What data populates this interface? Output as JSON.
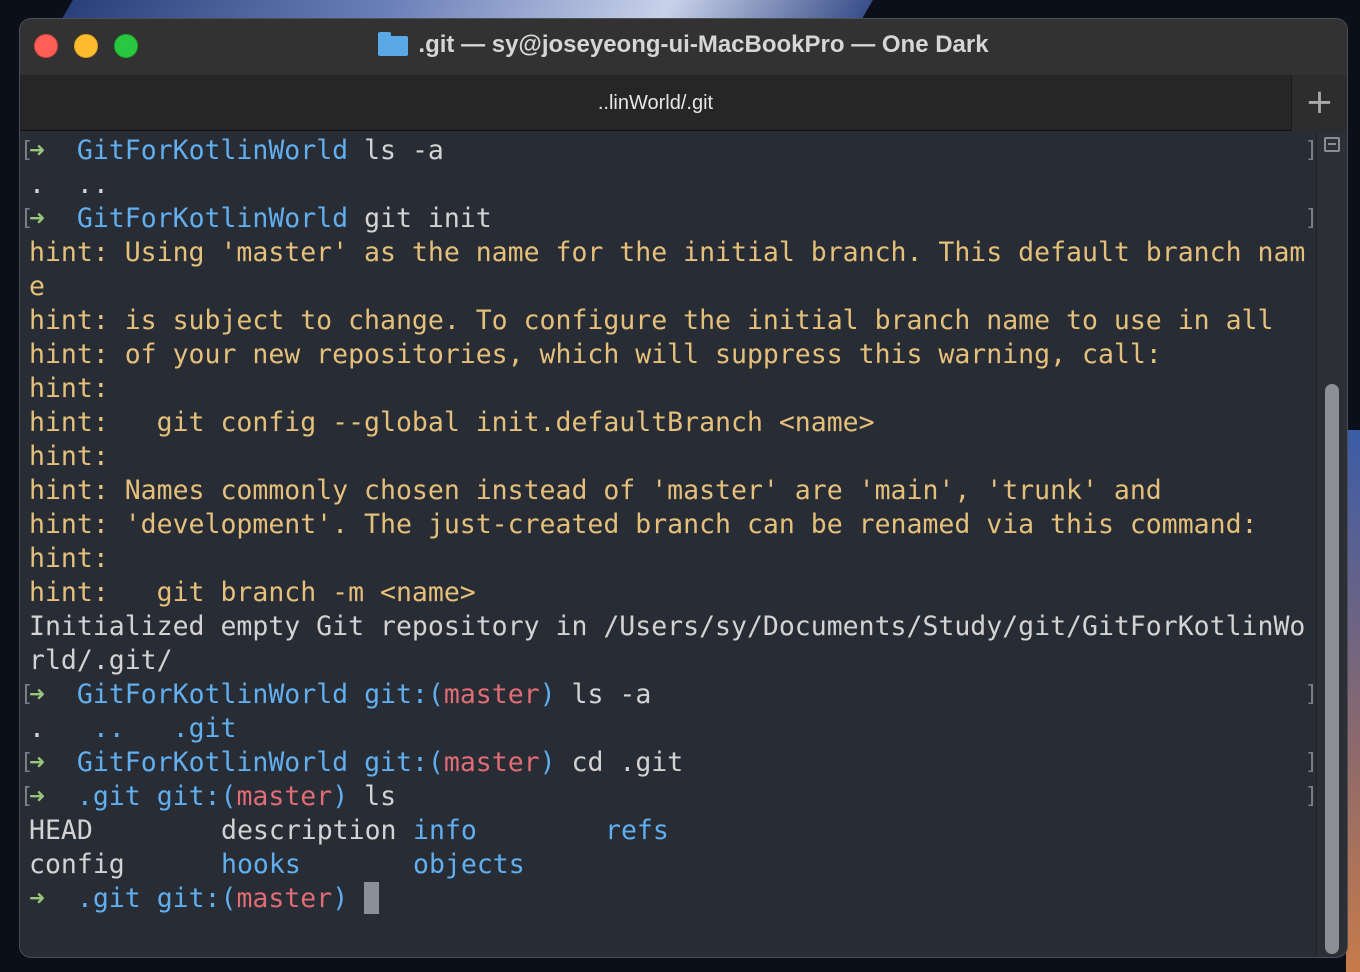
{
  "window": {
    "title": ".git — sy@joseyeong-ui-MacBookPro — One Dark",
    "folder_icon": "folder-icon",
    "traffic_lights": [
      "close",
      "minimize",
      "zoom"
    ]
  },
  "tabbar": {
    "tab_label": "..linWorld/.git",
    "new_tab_label": "+"
  },
  "colors": {
    "background": "#282c34",
    "prompt_arrow": "#98c379",
    "directory": "#61afef",
    "git_branch": "#e06c75",
    "hint_text": "#e5c07b",
    "plain_text": "#d3d3d3"
  },
  "terminal": {
    "prompt_arrow": "➜",
    "bracket_left": "[",
    "bracket_right": "]",
    "p1": {
      "dir": "GitForKotlinWorld",
      "cmd": " ls -a"
    },
    "out1": ".  ..",
    "p2": {
      "dir": "GitForKotlinWorld",
      "cmd": " git init"
    },
    "hints": [
      "hint: Using 'master' as the name for the initial branch. This default branch nam",
      "e",
      "hint: is subject to change. To configure the initial branch name to use in all",
      "hint: of your new repositories, which will suppress this warning, call:",
      "hint:",
      "hint:   git config --global init.defaultBranch <name>",
      "hint:",
      "hint: Names commonly chosen instead of 'master' are 'main', 'trunk' and",
      "hint: 'development'. The just-created branch can be renamed via this command:",
      "hint:",
      "hint:   git branch -m <name>"
    ],
    "init_msg": [
      "Initialized empty Git repository in /Users/sy/Documents/Study/git/GitForKotlinWo",
      "rld/.git/"
    ],
    "p3": {
      "dir": "GitForKotlinWorld",
      "git_open": "git:(",
      "branch": "master",
      "git_close": ")",
      "cmd": " ls -a"
    },
    "out3": {
      "a": ".",
      "b": "..",
      "c": ".git"
    },
    "p4": {
      "dir": "GitForKotlinWorld",
      "git_open": "git:(",
      "branch": "master",
      "git_close": ")",
      "cmd": " cd .git"
    },
    "p5": {
      "dir": ".git",
      "git_open": "git:(",
      "branch": "master",
      "git_close": ")",
      "cmd": " ls"
    },
    "ls_rows": [
      [
        "HEAD",
        "description",
        "info",
        "refs"
      ],
      [
        "config",
        "hooks",
        "objects",
        ""
      ]
    ],
    "p6": {
      "dir": ".git",
      "git_open": "git:(",
      "branch": "master",
      "git_close": ")"
    }
  }
}
